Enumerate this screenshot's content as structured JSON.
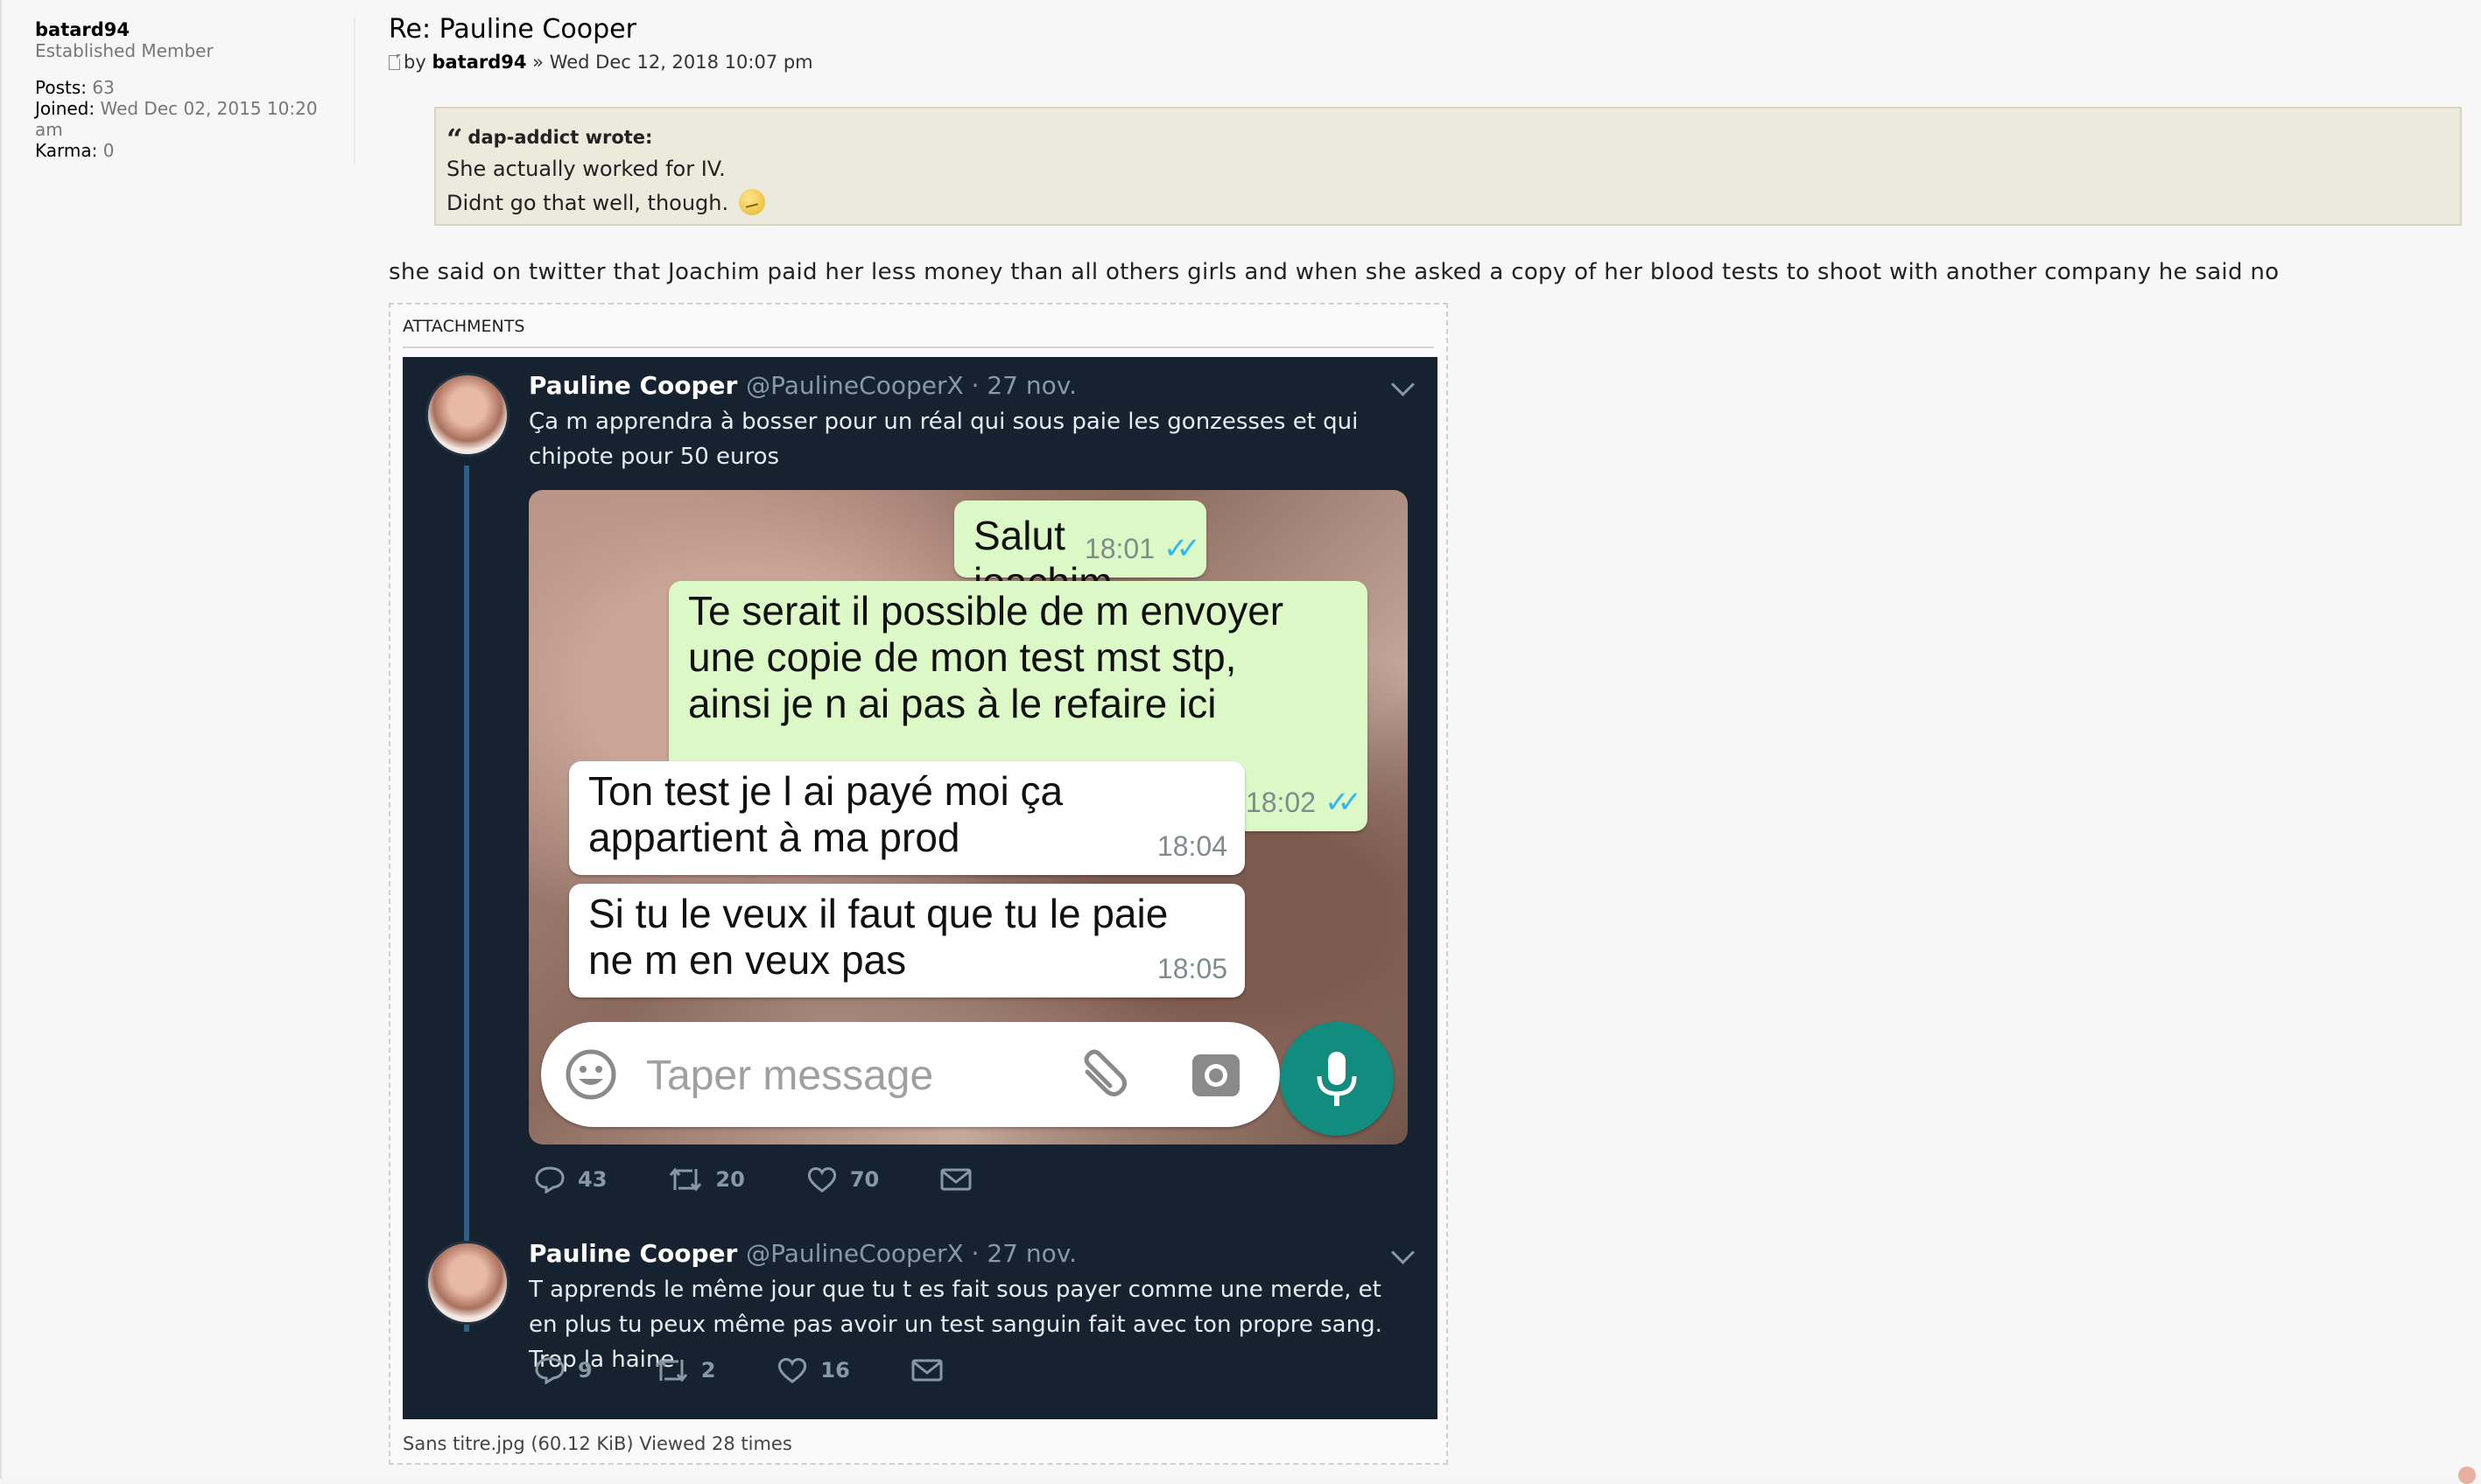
{
  "profile": {
    "username": "batard94",
    "rank": "Established Member",
    "posts_label": "Posts:",
    "posts": "63",
    "joined_label": "Joined:",
    "joined": "Wed Dec 02, 2015 10:20 am",
    "karma_label": "Karma:",
    "karma": "0"
  },
  "post": {
    "title": "Re: Pauline Cooper",
    "by": "by",
    "author": "batard94",
    "date": "» Wed Dec 12, 2018 10:07 pm",
    "quote": {
      "author": "dap-addict wrote:",
      "line1": "She actually worked for IV.",
      "line2": "Didnt go that well, though."
    },
    "text": "she said on twitter that Joachim paid her less money than all others girls and when she asked a copy of her blood tests to shoot with another company he said no"
  },
  "attachments": {
    "heading": "ATTACHMENTS",
    "caption": "Sans titre.jpg (60.12 KiB) Viewed 28 times"
  },
  "tweets": [
    {
      "name": "Pauline Cooper",
      "meta": "@PaulineCooperX · 27 nov.",
      "text": "Ça m apprendra à bosser pour un réal qui sous paie les gonzesses et qui chipote pour 50 euros",
      "replies": "43",
      "retweets": "20",
      "likes": "70"
    },
    {
      "name": "Pauline Cooper",
      "meta": "@PaulineCooperX · 27 nov.",
      "text": "T apprends le même jour que tu t es fait sous payer comme une merde, et en plus tu peux même pas avoir un test sanguin fait avec ton propre sang.  Trop la haine",
      "replies": "9",
      "retweets": "2",
      "likes": "16"
    }
  ],
  "chat": {
    "messages": [
      {
        "text": "Salut joachim",
        "time": "18:01",
        "ticks": "✓✓"
      },
      {
        "text": "Te serait il possible de m envoyer une copie de mon test mst stp, ainsi je n ai pas à le refaire ici",
        "time": "18:02",
        "ticks": "✓✓"
      },
      {
        "text": "Ton test je l ai payé moi ça appartient à ma prod",
        "time": "18:04"
      },
      {
        "text": "Si tu le veux il faut que tu le paie ne m en veux pas",
        "time": "18:05"
      }
    ],
    "placeholder": "Taper message"
  },
  "colors": {
    "quote_bg": "#ebeadd",
    "tweet_bg": "#172230",
    "bubble_out": "#dcf8c6",
    "bubble_in": "#ffffff",
    "whatsapp_green": "#128c7e",
    "read_ticks": "#34b7f1"
  },
  "icons": [
    "post-icon",
    "quote-icon",
    "smiley-icon",
    "chevron-down-icon",
    "reply-icon",
    "retweet-icon",
    "like-icon",
    "message-icon",
    "emoji-icon",
    "attach-icon",
    "camera-icon",
    "mic-icon"
  ]
}
